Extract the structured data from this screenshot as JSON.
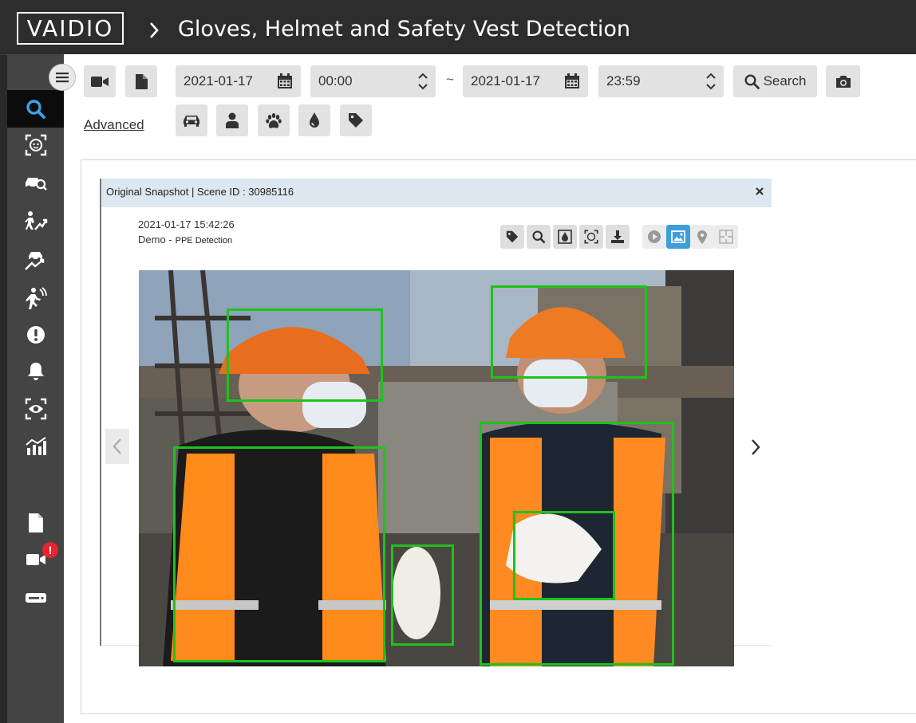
{
  "header": {
    "logo_text": "VAIDIO",
    "title": "Gloves, Helmet and Safety Vest Detection"
  },
  "sidebar": {
    "items": [
      {
        "icon": "search-icon",
        "active": true
      },
      {
        "icon": "face-scan-icon"
      },
      {
        "icon": "vehicle-search-icon"
      },
      {
        "icon": "person-motion-icon"
      },
      {
        "icon": "vehicle-motion-icon"
      },
      {
        "icon": "person-alert-icon"
      },
      {
        "icon": "exclamation-icon"
      },
      {
        "icon": "bell-icon"
      },
      {
        "icon": "eye-scan-icon"
      },
      {
        "icon": "chart-icon"
      },
      {
        "icon": "document-icon"
      },
      {
        "icon": "camera-icon",
        "badge": "!"
      },
      {
        "icon": "server-icon"
      }
    ]
  },
  "toolbar": {
    "start_date": "2021-01-17",
    "start_time": "00:00",
    "range_separator": "~",
    "end_date": "2021-01-17",
    "end_time": "23:59",
    "search_label": "Search",
    "advanced_label": "Advanced",
    "filter_icons": [
      "car-icon",
      "person-icon",
      "paw-icon",
      "drop-icon",
      "tag-icon"
    ]
  },
  "snapshot": {
    "title": "Original Snapshot | Scene ID : 30985116",
    "timestamp": "2021-01-17 15:42:26",
    "camera": "Demo -",
    "analytic": "PPE Detection",
    "detections": [
      {
        "label": "helmet"
      },
      {
        "label": "helmet"
      },
      {
        "label": "safety-vest"
      },
      {
        "label": "safety-vest"
      },
      {
        "label": "gloves"
      },
      {
        "label": "gloves"
      }
    ]
  },
  "colors": {
    "accent": "#3d9ed8",
    "detection_box": "#1fc21b",
    "badge": "#e8232f"
  }
}
